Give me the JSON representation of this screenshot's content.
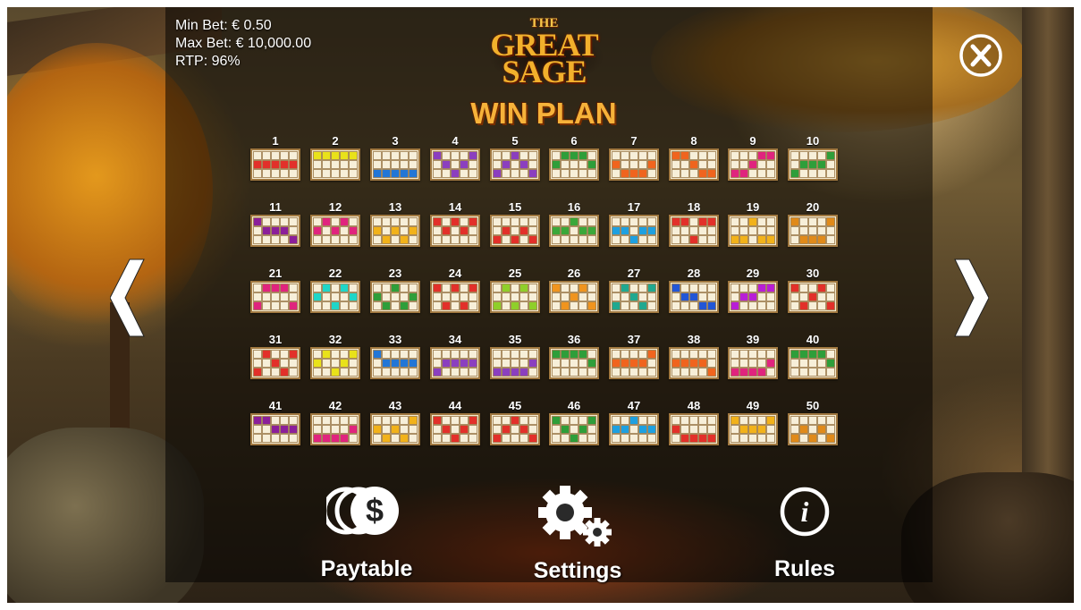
{
  "bet_info": {
    "min_bet": "Min Bet: € 0.50",
    "max_bet": "Max Bet: € 10,000.00",
    "rtp": "RTP: 96%"
  },
  "logo": {
    "line1": "THE",
    "line2": "GREAT",
    "line3": "SAGE"
  },
  "page_title": "WIN PLAN",
  "navigation": {
    "prev_icon": "chevron-left-icon",
    "next_icon": "chevron-right-icon",
    "close_icon": "close-x-icon"
  },
  "footer": {
    "paytable_label": "Paytable",
    "paytable_icon": "coins-dollar-icon",
    "settings_label": "Settings",
    "settings_icon": "gears-icon",
    "rules_label": "Rules",
    "rules_icon": "info-icon"
  },
  "paylines": [
    {
      "number": "1",
      "color": "#e2302a",
      "rows": [
        1,
        1,
        1,
        1,
        1
      ]
    },
    {
      "number": "2",
      "color": "#e9e21a",
      "rows": [
        0,
        0,
        0,
        0,
        0
      ]
    },
    {
      "number": "3",
      "color": "#2276d6",
      "rows": [
        2,
        2,
        2,
        2,
        2
      ]
    },
    {
      "number": "4",
      "color": "#8b3fbf",
      "rows": [
        0,
        1,
        2,
        1,
        0
      ]
    },
    {
      "number": "5",
      "color": "#8b3fbf",
      "rows": [
        2,
        1,
        0,
        1,
        2
      ]
    },
    {
      "number": "6",
      "color": "#2e9e3a",
      "rows": [
        1,
        0,
        0,
        0,
        1
      ]
    },
    {
      "number": "7",
      "color": "#f0641e",
      "rows": [
        1,
        2,
        2,
        2,
        1
      ]
    },
    {
      "number": "8",
      "color": "#f0641e",
      "rows": [
        0,
        0,
        1,
        2,
        2
      ]
    },
    {
      "number": "9",
      "color": "#e0247e",
      "rows": [
        2,
        2,
        1,
        0,
        0
      ]
    },
    {
      "number": "10",
      "color": "#2e9e3a",
      "rows": [
        2,
        1,
        1,
        1,
        0
      ]
    },
    {
      "number": "11",
      "color": "#8b1f9a",
      "rows": [
        0,
        1,
        1,
        1,
        2
      ]
    },
    {
      "number": "12",
      "color": "#e0247e",
      "rows": [
        1,
        0,
        1,
        0,
        1
      ]
    },
    {
      "number": "13",
      "color": "#f2b21a",
      "rows": [
        1,
        2,
        1,
        2,
        1
      ]
    },
    {
      "number": "14",
      "color": "#e2302a",
      "rows": [
        0,
        1,
        0,
        1,
        0
      ]
    },
    {
      "number": "15",
      "color": "#e2302a",
      "rows": [
        2,
        1,
        2,
        1,
        2
      ]
    },
    {
      "number": "16",
      "color": "#3aa83a",
      "rows": [
        1,
        1,
        0,
        1,
        1
      ]
    },
    {
      "number": "17",
      "color": "#1ea0e0",
      "rows": [
        1,
        1,
        2,
        1,
        1
      ]
    },
    {
      "number": "18",
      "color": "#e2302a",
      "rows": [
        0,
        0,
        2,
        0,
        0
      ]
    },
    {
      "number": "19",
      "color": "#f2b21a",
      "rows": [
        2,
        2,
        0,
        2,
        2
      ]
    },
    {
      "number": "20",
      "color": "#e08a1a",
      "rows": [
        0,
        2,
        2,
        2,
        0
      ]
    },
    {
      "number": "21",
      "color": "#e0247e",
      "rows": [
        2,
        0,
        0,
        0,
        2
      ]
    },
    {
      "number": "22",
      "color": "#1ed6c8",
      "rows": [
        1,
        0,
        2,
        0,
        1
      ]
    },
    {
      "number": "23",
      "color": "#2e9e3a",
      "rows": [
        1,
        2,
        0,
        2,
        1
      ]
    },
    {
      "number": "24",
      "color": "#e2302a",
      "rows": [
        0,
        2,
        0,
        2,
        0
      ]
    },
    {
      "number": "25",
      "color": "#8fcf2a",
      "rows": [
        2,
        0,
        2,
        0,
        2
      ]
    },
    {
      "number": "26",
      "color": "#f0941e",
      "rows": [
        0,
        2,
        1,
        0,
        2
      ]
    },
    {
      "number": "27",
      "color": "#20a890",
      "rows": [
        2,
        0,
        1,
        2,
        0
      ]
    },
    {
      "number": "28",
      "color": "#2256d6",
      "rows": [
        0,
        1,
        1,
        2,
        2
      ]
    },
    {
      "number": "29",
      "color": "#b81ed6",
      "rows": [
        2,
        1,
        1,
        0,
        0
      ]
    },
    {
      "number": "30",
      "color": "#e2302a",
      "rows": [
        0,
        2,
        1,
        0,
        2
      ]
    },
    {
      "number": "31",
      "color": "#e2302a",
      "rows": [
        2,
        0,
        1,
        2,
        0
      ]
    },
    {
      "number": "32",
      "color": "#e9e21a",
      "rows": [
        1,
        0,
        2,
        1,
        0
      ]
    },
    {
      "number": "33",
      "color": "#2276d6",
      "rows": [
        0,
        1,
        1,
        1,
        1
      ]
    },
    {
      "number": "34",
      "color": "#8b3fbf",
      "rows": [
        2,
        1,
        1,
        1,
        1
      ]
    },
    {
      "number": "35",
      "color": "#8b3fbf",
      "rows": [
        2,
        2,
        2,
        2,
        1
      ]
    },
    {
      "number": "36",
      "color": "#2e9e3a",
      "rows": [
        0,
        0,
        0,
        0,
        1
      ]
    },
    {
      "number": "37",
      "color": "#f0641e",
      "rows": [
        1,
        1,
        1,
        1,
        0
      ]
    },
    {
      "number": "38",
      "color": "#f0641e",
      "rows": [
        1,
        1,
        1,
        1,
        2
      ]
    },
    {
      "number": "39",
      "color": "#e0247e",
      "rows": [
        2,
        2,
        2,
        2,
        1
      ]
    },
    {
      "number": "40",
      "color": "#2e9e3a",
      "rows": [
        0,
        0,
        0,
        0,
        1
      ]
    },
    {
      "number": "41",
      "color": "#8b1f9a",
      "rows": [
        0,
        0,
        1,
        1,
        1
      ]
    },
    {
      "number": "42",
      "color": "#e0247e",
      "rows": [
        2,
        2,
        2,
        2,
        1
      ]
    },
    {
      "number": "43",
      "color": "#f2b21a",
      "rows": [
        1,
        2,
        1,
        2,
        0
      ]
    },
    {
      "number": "44",
      "color": "#e2302a",
      "rows": [
        0,
        1,
        2,
        1,
        0
      ]
    },
    {
      "number": "45",
      "color": "#e2302a",
      "rows": [
        2,
        1,
        0,
        1,
        2
      ]
    },
    {
      "number": "46",
      "color": "#2e9e3a",
      "rows": [
        0,
        1,
        2,
        1,
        0
      ]
    },
    {
      "number": "47",
      "color": "#1ea0e0",
      "rows": [
        1,
        1,
        0,
        1,
        1
      ]
    },
    {
      "number": "48",
      "color": "#e2302a",
      "rows": [
        1,
        2,
        2,
        2,
        2
      ]
    },
    {
      "number": "49",
      "color": "#f2b21a",
      "rows": [
        0,
        1,
        1,
        1,
        0
      ]
    },
    {
      "number": "50",
      "color": "#e08a1a",
      "rows": [
        2,
        1,
        2,
        1,
        2
      ]
    }
  ]
}
